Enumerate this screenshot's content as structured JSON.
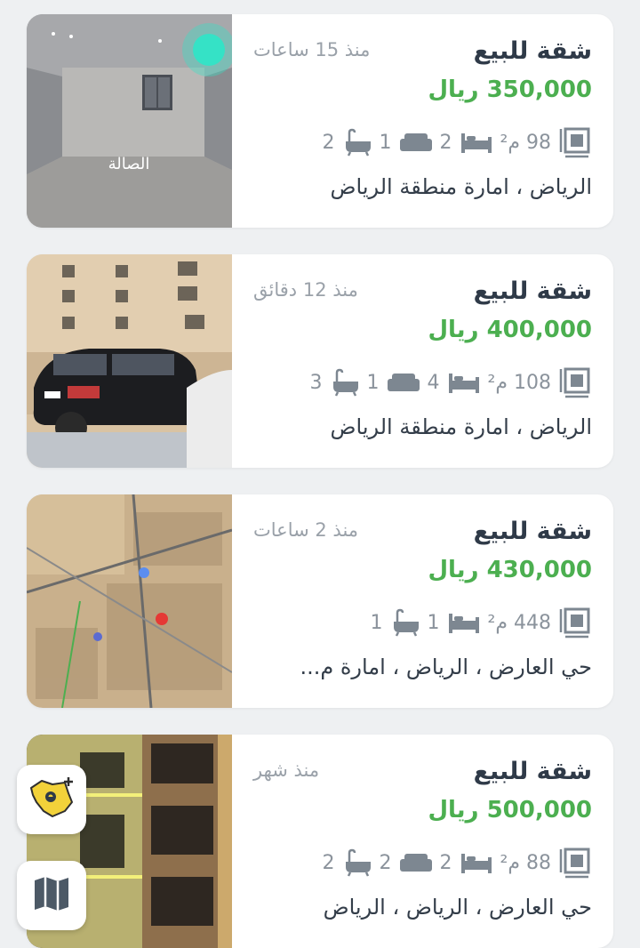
{
  "listings": [
    {
      "title": "شقة للبيع",
      "time": "منذ 15 ساعات",
      "price": "350,000 ريال",
      "area": "98 م²",
      "bedrooms": "2",
      "living_rooms": "1",
      "bathrooms": "2",
      "location": "الرياض ، امارة منطقة الرياض",
      "photo_caption": "الصالة"
    },
    {
      "title": "شقة للبيع",
      "time": "منذ 12 دقائق",
      "price": "400,000 ريال",
      "area": "108 م²",
      "bedrooms": "4",
      "living_rooms": "1",
      "bathrooms": "3",
      "location": "الرياض ، امارة منطقة الرياض"
    },
    {
      "title": "شقة للبيع",
      "time": "منذ 2 ساعات",
      "price": "430,000 ريال",
      "area": "448 م²",
      "bedrooms": "1",
      "bathrooms": "1",
      "location": "حي العارض ، الرياض ، امارة م..."
    },
    {
      "title": "شقة للبيع",
      "time": "منذ شهر",
      "price": "500,000 ريال",
      "area": "88 م²",
      "bedrooms": "2",
      "living_rooms": "2",
      "bathrooms": "2",
      "location": "حي العارض ، الرياض ، الرياض"
    }
  ],
  "icons": {
    "area": "area-measure-icon",
    "bedrooms": "bed-icon",
    "living_rooms": "sofa-icon",
    "bathrooms": "bathtub-icon",
    "fab_top": "saudi-map-add-location-icon",
    "fab_bottom": "folded-map-icon"
  },
  "colors": {
    "price": "#4caf50",
    "title": "#2f3a48",
    "muted": "#9aa1a9",
    "icon": "#7d8791",
    "background": "#eef0f2"
  }
}
